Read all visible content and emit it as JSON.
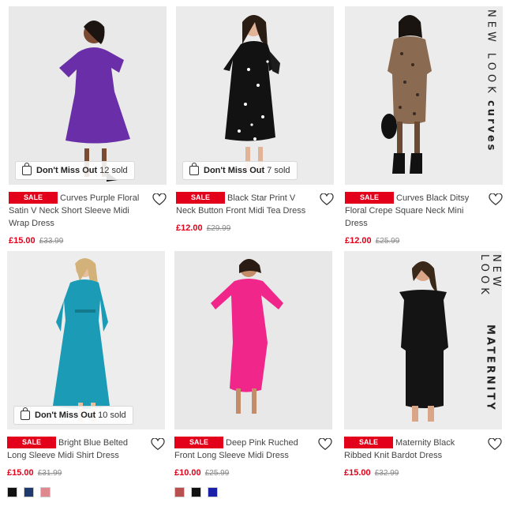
{
  "products": [
    {
      "sale_label": "SALE",
      "title": "Curves Purple Floral Satin V Neck Short Sleeve Midi Wrap Dress",
      "price": "£15.00",
      "was_price": "£33.99",
      "promo": {
        "label": "Don't Miss Out",
        "sold": "12 sold"
      },
      "colors": {
        "bg": "#e9e9e9",
        "dress": "#6a2fa8",
        "skin": "#7a4a32"
      }
    },
    {
      "sale_label": "SALE",
      "title": "Black Star Print V Neck Button Front Midi Tea Dress",
      "price": "£12.00",
      "was_price": "£29.99",
      "promo": {
        "label": "Don't Miss Out",
        "sold": "7 sold"
      },
      "colors": {
        "bg": "#ebebeb",
        "dress": "#121212",
        "skin": "#e2b497"
      }
    },
    {
      "sale_label": "SALE",
      "title": "Curves Black Ditsy Floral Crepe Square Neck Mini Dress",
      "price": "£12.00",
      "was_price": "£25.99",
      "brand_letters": "NEW LOOK",
      "brand_sub": "curves",
      "colors": {
        "bg": "#ececec",
        "dress": "#8a6a50",
        "skin": "#6b4a34"
      }
    },
    {
      "sale_label": "SALE",
      "title": "Bright Blue Belted Long Sleeve Midi Shirt Dress",
      "price": "£15.00",
      "was_price": "£31.99",
      "promo": {
        "label": "Don't Miss Out",
        "sold": "10 sold"
      },
      "colors": {
        "bg": "#ededed",
        "dress": "#1b9bb5",
        "skin": "#e6bf9f"
      },
      "swatches": [
        "#111111",
        "#1e3a6e",
        "#e08890"
      ]
    },
    {
      "sale_label": "SALE",
      "title": "Deep Pink Ruched Front Long Sleeve Midi Dress",
      "price": "£10.00",
      "was_price": "£25.99",
      "colors": {
        "bg": "#e8e8e8",
        "dress": "#f0268a",
        "skin": "#c48c68"
      },
      "swatches": [
        "#b85050",
        "#111111",
        "#1a20a8"
      ]
    },
    {
      "sale_label": "SALE",
      "title": "Maternity Black Ribbed Knit Bardot Dress",
      "price": "£15.00",
      "was_price": "£32.99",
      "brand_letters": "NEW LOOK",
      "brand_sub": "MATERNITY",
      "colors": {
        "bg": "#ececec",
        "dress": "#141414",
        "skin": "#d9a788"
      }
    }
  ]
}
